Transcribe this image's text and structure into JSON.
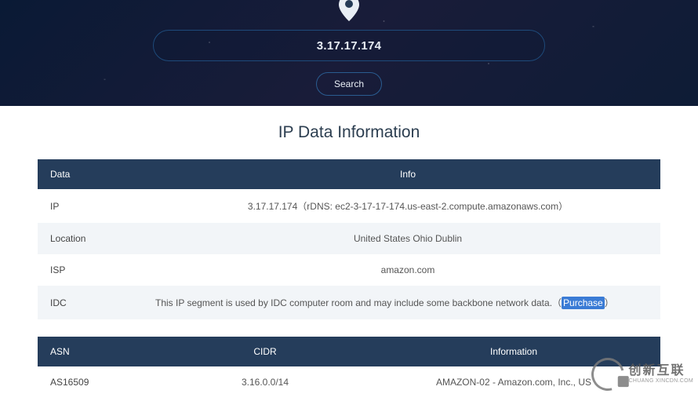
{
  "hero": {
    "query": "3.17.17.174",
    "search_label": "Search"
  },
  "title": "IP Data Information",
  "info_table": {
    "headers": {
      "data": "Data",
      "info": "Info"
    },
    "rows": [
      {
        "label": "IP",
        "value": "3.17.17.174（rDNS: ec2-3-17-17-174.us-east-2.compute.amazonaws.com）"
      },
      {
        "label": "Location",
        "value": "United States Ohio Dublin"
      },
      {
        "label": "ISP",
        "value": "amazon.com"
      },
      {
        "label": "IDC",
        "value_prefix": "This IP segment is used by IDC computer room and may include some backbone network data.（",
        "purchase_label": "Purchase",
        "value_suffix": "）"
      }
    ]
  },
  "asn_table": {
    "headers": {
      "asn": "ASN",
      "cidr": "CIDR",
      "info": "Information"
    },
    "rows": [
      {
        "asn": "AS16509",
        "cidr": "3.16.0.0/14",
        "info": "AMAZON-02 - Amazon.com, Inc., US"
      }
    ]
  },
  "watermark": {
    "cn": "创新互联",
    "en": "CHUANG XINCDN.COM"
  }
}
